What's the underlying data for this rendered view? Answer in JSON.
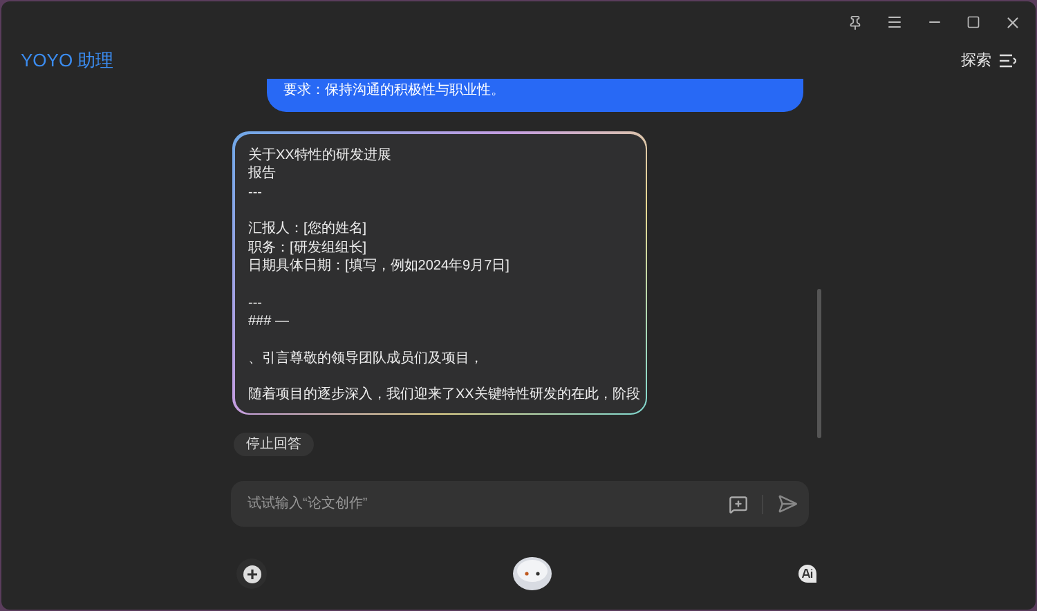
{
  "app": {
    "title": "YOYO 助理",
    "explore": "探索"
  },
  "user_message": {
    "text": "要求：保持沟通的积极性与职业性。"
  },
  "reply": {
    "paragraphs": [
      [
        "关于XX特性的研发进展",
        "报告",
        "---"
      ],
      [
        "汇报人：[您的姓名]",
        "职务：[研发组组长]",
        "日期具体日期：[填写，例如2024年9月7日]"
      ],
      [
        "---",
        "### —"
      ],
      [
        "、引言尊敬的领导团队成员们及项目，"
      ],
      [
        "随着项目的逐步深入，我们迎来了XX关键特性研发的在此，阶段"
      ]
    ]
  },
  "stop_button": "停止回答",
  "input": {
    "placeholder": "试试输入“论文创作”"
  }
}
